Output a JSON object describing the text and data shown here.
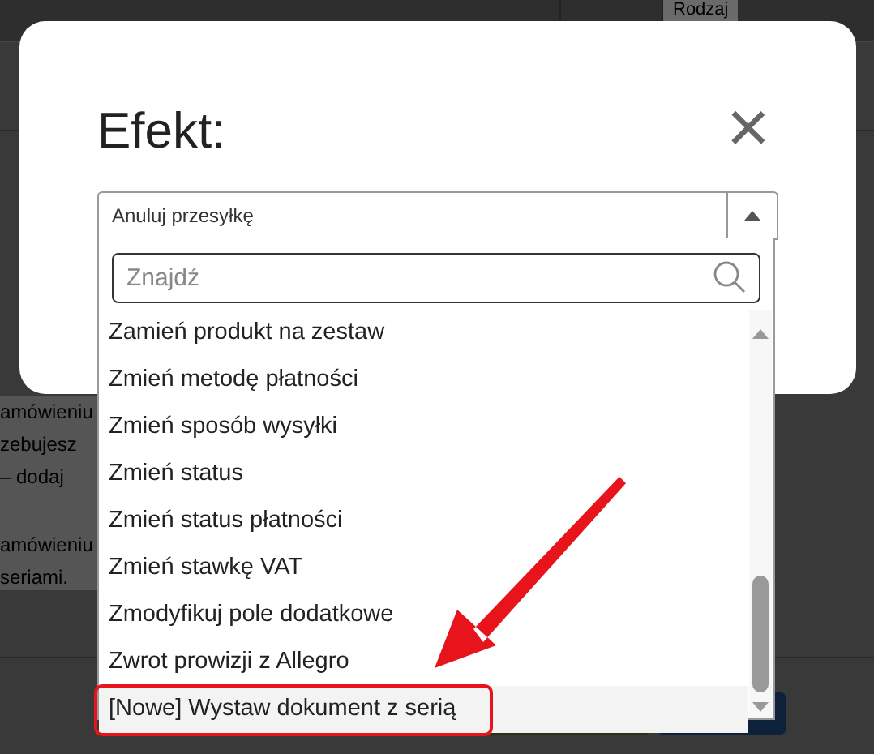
{
  "background": {
    "column_header": "Rodzaj",
    "texts": [
      "amówieniu",
      "zebujesz",
      "– dodaj",
      "amówieniu",
      "seriami."
    ]
  },
  "dialog": {
    "title": "Efekt:",
    "close": "×"
  },
  "select": {
    "value": "Anuluj przesyłkę",
    "search": {
      "placeholder": "Znajdź"
    },
    "options": [
      {
        "label": "Zamień produkt na zestaw",
        "selected": false
      },
      {
        "label": "Zmień metodę płatności",
        "selected": false
      },
      {
        "label": "Zmień sposób wysyłki",
        "selected": false
      },
      {
        "label": "Zmień status",
        "selected": false
      },
      {
        "label": "Zmień status płatności",
        "selected": false
      },
      {
        "label": "Zmień stawkę VAT",
        "selected": false
      },
      {
        "label": "Zmodyfikuj pole dodatkowe",
        "selected": false
      },
      {
        "label": "Zwrot prowizji z Allegro",
        "selected": false
      },
      {
        "label": "[Nowe] Wystaw dokument z serią",
        "selected": true
      }
    ]
  }
}
